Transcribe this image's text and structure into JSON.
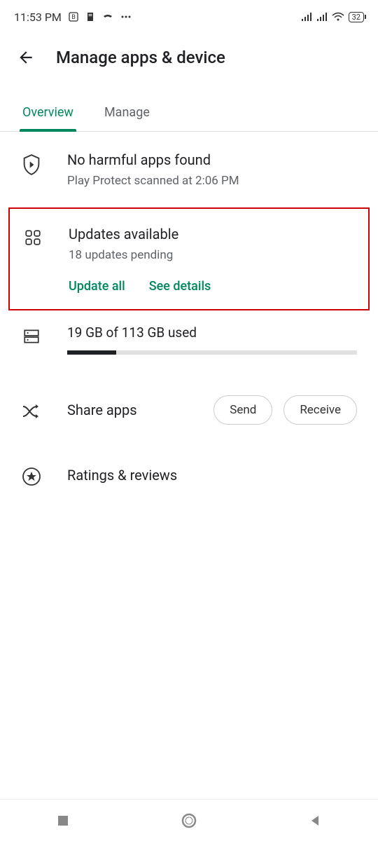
{
  "status_bar": {
    "time": "11:53 PM",
    "battery": "32"
  },
  "header": {
    "title": "Manage apps & device"
  },
  "tabs": {
    "overview": "Overview",
    "manage": "Manage"
  },
  "play_protect": {
    "title": "No harmful apps found",
    "subtitle": "Play Protect scanned at 2:06 PM"
  },
  "updates": {
    "title": "Updates available",
    "subtitle": "18 updates pending",
    "update_all": "Update all",
    "see_details": "See details"
  },
  "storage": {
    "text": "19 GB of 113 GB used"
  },
  "share": {
    "title": "Share apps",
    "send": "Send",
    "receive": "Receive"
  },
  "ratings": {
    "title": "Ratings & reviews"
  }
}
